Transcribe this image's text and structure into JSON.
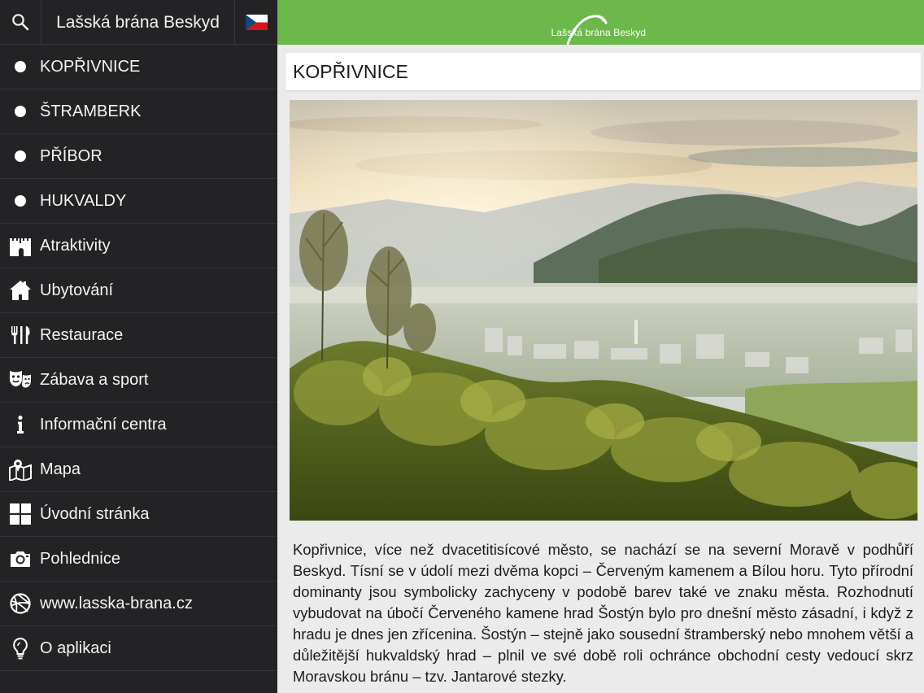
{
  "sidebar": {
    "title": "Lašská brána Beskyd",
    "items": [
      {
        "label": "KOPŘIVNICE",
        "icon": "bullet-icon"
      },
      {
        "label": "ŠTRAMBERK",
        "icon": "bullet-icon"
      },
      {
        "label": "PŘÍBOR",
        "icon": "bullet-icon"
      },
      {
        "label": "HUKVALDY",
        "icon": "bullet-icon"
      },
      {
        "label": "Atraktivity",
        "icon": "castle-icon"
      },
      {
        "label": "Ubytování",
        "icon": "house-icon"
      },
      {
        "label": "Restaurace",
        "icon": "cutlery-icon"
      },
      {
        "label": "Zábava a sport",
        "icon": "theater-masks-icon"
      },
      {
        "label": "Informační centra",
        "icon": "info-icon"
      },
      {
        "label": "Mapa",
        "icon": "map-pin-icon"
      },
      {
        "label": "Úvodní stránka",
        "icon": "grid-icon"
      },
      {
        "label": "Pohlednice",
        "icon": "camera-icon"
      },
      {
        "label": "www.lasska-brana.cz",
        "icon": "globe-ball-icon"
      },
      {
        "label": "O aplikaci",
        "icon": "lightbulb-icon"
      }
    ]
  },
  "header": {
    "logo_text": "Lašská brána Beskyd",
    "color": "#6cb84a"
  },
  "content": {
    "title": "KOPŘIVNICE",
    "body": "Kopřivnice, více než dvacetitisícové město, se nachází se na severní Moravě v podhůří Beskyd. Tísní se v údolí mezi dvěma kopci – Červeným kamenem a Bílou horu. Tyto přírodní dominanty jsou symbolicky zachyceny v podobě barev také ve znaku města. Rozhodnutí vybudovat na úbočí Červeného kamene hrad Šostýn bylo pro dnešní město zásadní, i když z hradu je dnes jen zřícenina. Šostýn – stejně jako sousední štramberský nebo mnohem větší a důležitější hukvaldský hrad – plnil ve své době roli ochránce obchodní cesty vedoucí skrz Moravskou bránu – tzv. Jantarové stezky."
  }
}
